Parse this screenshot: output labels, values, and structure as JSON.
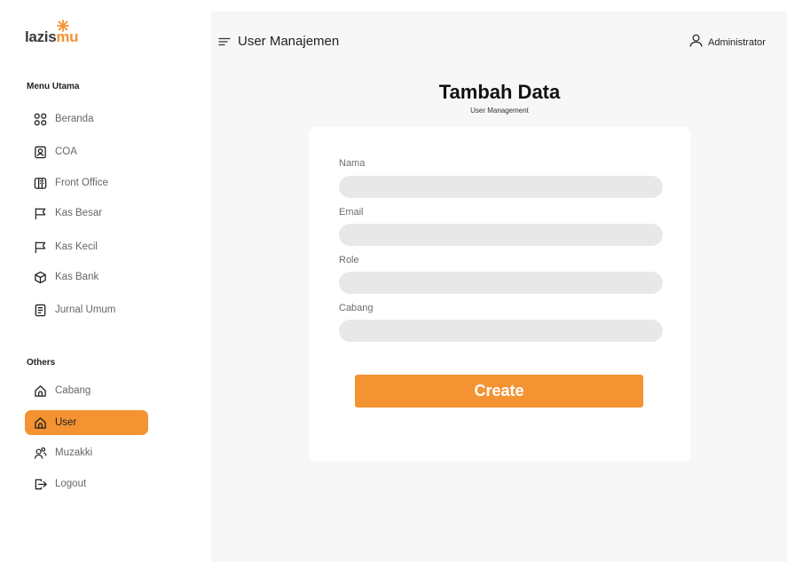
{
  "brand": {
    "logo_part1": "lazis",
    "logo_part2": "mu",
    "accent_color": "#f39332"
  },
  "sidebar": {
    "main_section_title": "Menu Utama",
    "main_items": [
      {
        "label": "Beranda",
        "icon": "grid-icon"
      },
      {
        "label": "COA",
        "icon": "contact-card-icon"
      },
      {
        "label": "Front Office",
        "icon": "building-icon"
      },
      {
        "label": "Kas Besar",
        "icon": "flag-icon"
      },
      {
        "label": "Kas Kecil",
        "icon": "flag-icon"
      },
      {
        "label": "Kas Bank",
        "icon": "cube-icon"
      },
      {
        "label": "Jurnal Umum",
        "icon": "document-icon"
      }
    ],
    "others_section_title": "Others",
    "other_items": [
      {
        "label": "Cabang",
        "icon": "home-icon",
        "active": false
      },
      {
        "label": "User",
        "icon": "home-icon",
        "active": true
      },
      {
        "label": "Muzakki",
        "icon": "users-icon",
        "active": false
      },
      {
        "label": "Logout",
        "icon": "logout-icon",
        "active": false
      }
    ]
  },
  "header": {
    "menu_icon": "hamburger-menu-icon",
    "title": "User Manajemen",
    "user_icon": "user-icon",
    "user_name": "Administrator"
  },
  "page": {
    "heading": "Tambah Data",
    "subheading": "User Management"
  },
  "form": {
    "fields": [
      {
        "label": "Nama",
        "value": ""
      },
      {
        "label": "Email",
        "value": ""
      },
      {
        "label": "Role",
        "value": ""
      },
      {
        "label": "Cabang",
        "value": ""
      }
    ],
    "submit_label": "Create"
  }
}
